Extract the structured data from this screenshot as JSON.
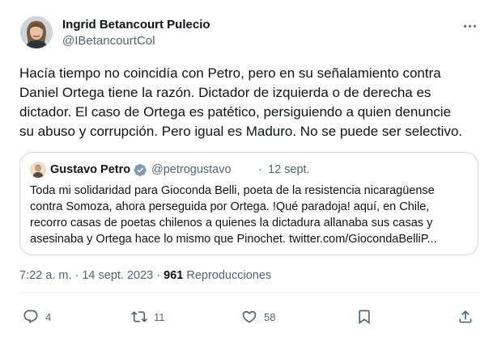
{
  "author": {
    "name": "Ingrid Betancourt Pulecio",
    "handle": "@IBetancourtCol"
  },
  "tweet": {
    "text": "Hacía tiempo no coincidía con Petro, pero en su señalamiento contra\nDaniel Ortega tiene la razón. Dictador de izquierda o de derecha es\ndictador. El caso de Ortega  es patético, persiguiendo a quien denuncie\nsu abuso y corrupción. Pero igual es Maduro. No se puede ser selectivo."
  },
  "quoted": {
    "name": "Gustavo Petro",
    "handle": "@petrogustavo",
    "separator": "·",
    "date": "12 sept.",
    "text": "Toda mi solidaridad para Gioconda Belli, poeta de la resistencia nicaragüense\ncontra Somoza, ahora perseguida por Ortega. !Qué paradoja! aquí, en Chile,\nrecorro casas de poetas chilenos a quienes la dictadura allanaba sus casas y\nasesinaba y Ortega hace lo mismo que Pinochet. twitter.com/GiocondaBelliP..."
  },
  "meta": {
    "time_date": "7:22 a. m. · 14 sept. 2023 · ",
    "views_count": "961",
    "views_label": " Reproducciones"
  },
  "actions": {
    "replies": "4",
    "retweets": "11",
    "likes": "58"
  },
  "colors": {
    "text_primary": "#0f1419",
    "text_secondary": "#536471",
    "verified_badge": "#829aab",
    "border": "#cfd9de"
  },
  "icons": {
    "more": "more-horizontal-icon",
    "verified": "verified-badge-icon",
    "reply": "reply-icon",
    "retweet": "retweet-icon",
    "like": "heart-icon",
    "bookmark": "bookmark-icon",
    "share": "share-icon"
  }
}
